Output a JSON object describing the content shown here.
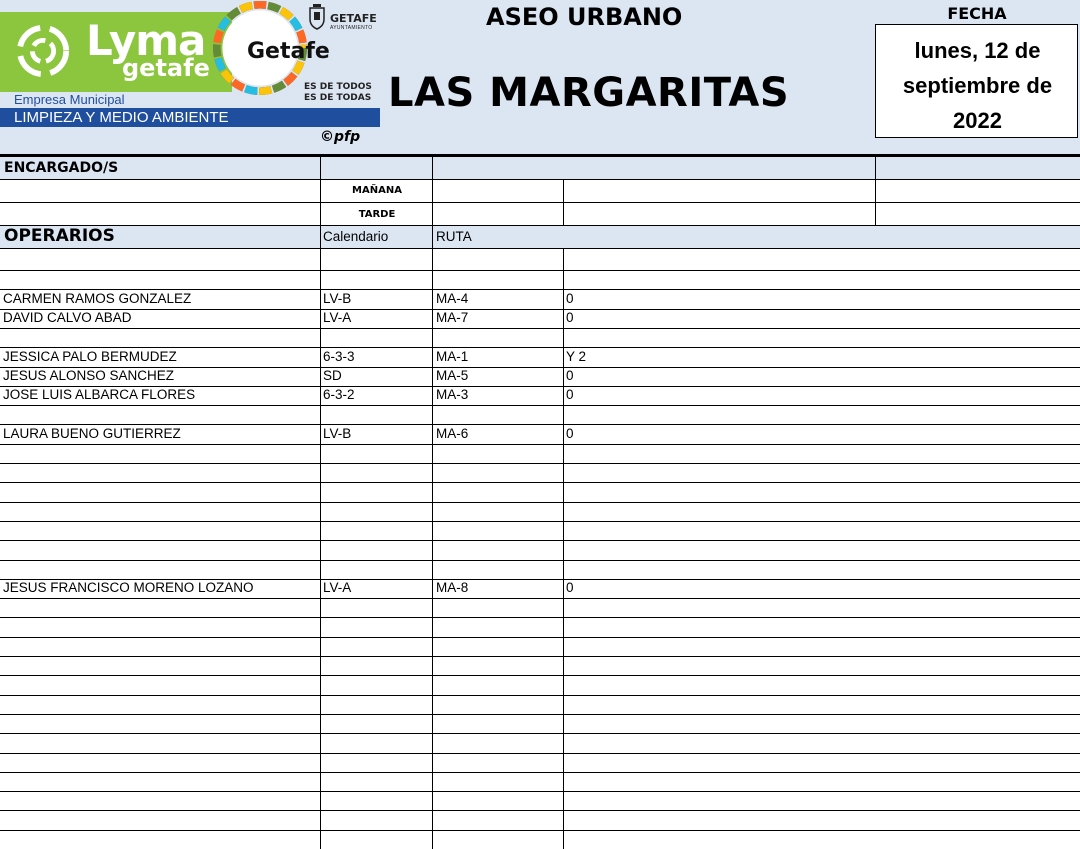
{
  "header": {
    "brand": "Lyma",
    "brand_sub": "getafe",
    "company_type": "Empresa Municipal",
    "company_division": "LIMPIEZA Y MEDIO AMBIENTE",
    "sdg_label": "Getafe",
    "city": "GETAFE",
    "city_sub": "AYUNTAMIENTO",
    "slogan_line1": "ES DE TODOS",
    "slogan_line2": "ES DE TODAS",
    "credit": "©pfp",
    "service": "ASEO URBANO",
    "site": "LAS MARGARITAS",
    "date_label": "FECHA",
    "date_value": "lunes, 12 de septiembre de 2022"
  },
  "managers": {
    "label": "ENCARGADO/S",
    "shifts": [
      "MAÑANA",
      "TARDE"
    ]
  },
  "workers": {
    "label": "OPERARIOS",
    "columns": [
      "Calendario",
      "RUTA"
    ],
    "rows": [
      {
        "name": "",
        "calendar": "",
        "route": "",
        "extra": ""
      },
      {
        "name": "",
        "calendar": "",
        "route": "",
        "extra": ""
      },
      {
        "name": "CARMEN RAMOS GONZALEZ",
        "calendar": "LV-B",
        "route": "MA-4",
        "extra": "0"
      },
      {
        "name": "DAVID CALVO ABAD",
        "calendar": "LV-A",
        "route": "MA-7",
        "extra": "0"
      },
      {
        "name": "",
        "calendar": "",
        "route": "",
        "extra": ""
      },
      {
        "name": "JESSICA PALO BERMUDEZ",
        "calendar": "6-3-3",
        "route": "MA-1",
        "extra": "Y 2"
      },
      {
        "name": "JESUS ALONSO SANCHEZ",
        "calendar": "SD",
        "route": "MA-5",
        "extra": "0"
      },
      {
        "name": "JOSE LUIS ALBARCA FLORES",
        "calendar": "6-3-2",
        "route": "MA-3",
        "extra": "0"
      },
      {
        "name": "",
        "calendar": "",
        "route": "",
        "extra": ""
      },
      {
        "name": "LAURA BUENO GUTIERREZ",
        "calendar": "LV-B",
        "route": "MA-6",
        "extra": "0"
      },
      {
        "name": "",
        "calendar": "",
        "route": "",
        "extra": ""
      },
      {
        "name": "",
        "calendar": "",
        "route": "",
        "extra": ""
      },
      {
        "name": "",
        "calendar": "",
        "route": "",
        "extra": ""
      },
      {
        "name": "",
        "calendar": "",
        "route": "",
        "extra": ""
      },
      {
        "name": "",
        "calendar": "",
        "route": "",
        "extra": ""
      },
      {
        "name": "",
        "calendar": "",
        "route": "",
        "extra": ""
      },
      {
        "name": "",
        "calendar": "",
        "route": "",
        "extra": ""
      },
      {
        "name": "JESUS FRANCISCO MORENO LOZANO",
        "calendar": "LV-A",
        "route": "MA-8",
        "extra": "0"
      },
      {
        "name": "",
        "calendar": "",
        "route": "",
        "extra": ""
      },
      {
        "name": "",
        "calendar": "",
        "route": "",
        "extra": ""
      },
      {
        "name": "",
        "calendar": "",
        "route": "",
        "extra": ""
      },
      {
        "name": "",
        "calendar": "",
        "route": "",
        "extra": ""
      },
      {
        "name": "",
        "calendar": "",
        "route": "",
        "extra": ""
      },
      {
        "name": "",
        "calendar": "",
        "route": "",
        "extra": ""
      },
      {
        "name": "",
        "calendar": "",
        "route": "",
        "extra": ""
      },
      {
        "name": "",
        "calendar": "",
        "route": "",
        "extra": ""
      },
      {
        "name": "",
        "calendar": "",
        "route": "",
        "extra": ""
      },
      {
        "name": "",
        "calendar": "",
        "route": "",
        "extra": ""
      },
      {
        "name": "",
        "calendar": "",
        "route": "",
        "extra": ""
      },
      {
        "name": "",
        "calendar": "",
        "route": "",
        "extra": ""
      }
    ]
  },
  "colors": {
    "header_bg": "#dce6f2",
    "brand_green": "#8cc63f",
    "brand_blue": "#1f4e9e"
  }
}
